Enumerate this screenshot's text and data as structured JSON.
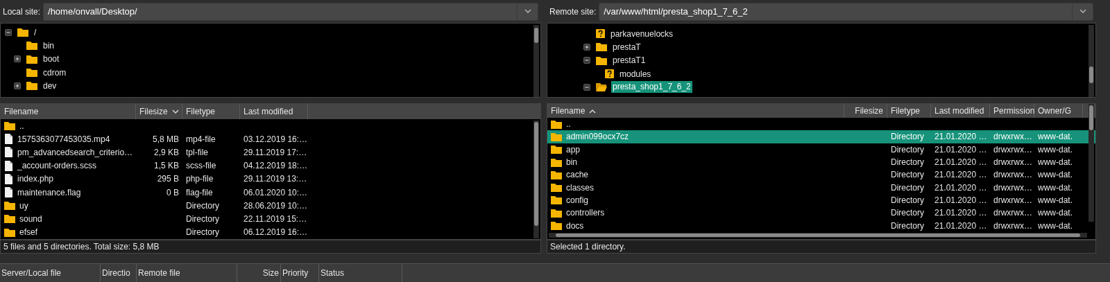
{
  "local": {
    "label": "Local site:",
    "path": "/home/onvall/Desktop/",
    "tree": [
      {
        "name": "/",
        "kind": "folder",
        "expandable": true,
        "expanded": true,
        "selected": false,
        "children": [
          {
            "name": "bin",
            "kind": "folder",
            "expandable": false,
            "selected": false
          },
          {
            "name": "boot",
            "kind": "folder",
            "expandable": true,
            "expanded": false,
            "selected": false
          },
          {
            "name": "cdrom",
            "kind": "folder",
            "expandable": false,
            "selected": false
          },
          {
            "name": "dev",
            "kind": "folder",
            "expandable": true,
            "expanded": false,
            "selected": false
          }
        ]
      }
    ],
    "listing": {
      "columns": [
        {
          "label": "Filename",
          "sorted": false
        },
        {
          "label": "Filesize",
          "sorted": true,
          "ascending": false
        },
        {
          "label": "Filetype",
          "sorted": false
        },
        {
          "label": "Last modified",
          "sorted": false
        }
      ],
      "rows": [
        {
          "kind": "folder",
          "selected": false,
          "filename": ".."
        },
        {
          "kind": "file",
          "selected": false,
          "filename": "1575363077453035.mp4",
          "filesize": "5,8 MB",
          "filetype": "mp4-file",
          "last_modified": "03.12.2019 16:…"
        },
        {
          "kind": "file",
          "selected": false,
          "filename": "pm_advancedsearch_criterio…",
          "filesize": "2,9 KB",
          "filetype": "tpl-file",
          "last_modified": "29.11.2019 17:…"
        },
        {
          "kind": "file",
          "selected": false,
          "filename": "_account-orders.scss",
          "filesize": "1,5 KB",
          "filetype": "scss-file",
          "last_modified": "04.12.2019 18:…"
        },
        {
          "kind": "file",
          "selected": false,
          "filename": "index.php",
          "filesize": "295 B",
          "filetype": "php-file",
          "last_modified": "29.11.2019 13:…"
        },
        {
          "kind": "file",
          "selected": false,
          "filename": "maintenance.flag",
          "filesize": "0 B",
          "filetype": "flag-file",
          "last_modified": "06.01.2020 10:…"
        },
        {
          "kind": "folder",
          "selected": false,
          "filename": "uy",
          "filetype": "Directory",
          "last_modified": "28.06.2019 10:…"
        },
        {
          "kind": "folder",
          "selected": false,
          "filename": "sound",
          "filetype": "Directory",
          "last_modified": "22.11.2019 15:…"
        },
        {
          "kind": "folder",
          "selected": false,
          "filename": "efsef",
          "filetype": "Directory",
          "last_modified": "06.12.2019 16:…"
        }
      ]
    },
    "status": "5 files and 5 directories. Total size: 5,8 MB"
  },
  "remote": {
    "label": "Remote site:",
    "path": "/var/www/html/presta_shop1_7_6_2",
    "tree": [
      {
        "name": "parkavenuelocks",
        "kind": "unknown",
        "expandable": false,
        "selected": false
      },
      {
        "name": "prestaT",
        "kind": "folder",
        "expandable": true,
        "expanded": false,
        "selected": false
      },
      {
        "name": "prestaT1",
        "kind": "folder",
        "expandable": true,
        "expanded": true,
        "selected": false,
        "children": [
          {
            "name": "modules",
            "kind": "unknown",
            "expandable": false,
            "selected": false
          }
        ]
      },
      {
        "name": "presta_shop1_7_6_2",
        "kind": "folder-open",
        "expandable": true,
        "expanded": true,
        "selected": true
      }
    ],
    "listing": {
      "columns": [
        {
          "label": "Filename",
          "sorted": true,
          "ascending": true
        },
        {
          "label": "Filesize",
          "sorted": false
        },
        {
          "label": "Filetype",
          "sorted": false
        },
        {
          "label": "Last modified",
          "sorted": false
        },
        {
          "label": "Permission",
          "sorted": false
        },
        {
          "label": "Owner/G",
          "sorted": false
        }
      ],
      "rows": [
        {
          "kind": "folder",
          "selected": false,
          "filename": ".."
        },
        {
          "kind": "folder",
          "selected": true,
          "filename": "admin099ocx7cz",
          "filetype": "Directory",
          "last_modified": "21.01.2020 …",
          "permission": "drwxrwx…",
          "owner": "www-dat."
        },
        {
          "kind": "folder",
          "selected": false,
          "filename": "app",
          "filetype": "Directory",
          "last_modified": "21.01.2020 …",
          "permission": "drwxrwx…",
          "owner": "www-dat."
        },
        {
          "kind": "folder",
          "selected": false,
          "filename": "bin",
          "filetype": "Directory",
          "last_modified": "21.01.2020 …",
          "permission": "drwxrwx…",
          "owner": "www-dat."
        },
        {
          "kind": "folder",
          "selected": false,
          "filename": "cache",
          "filetype": "Directory",
          "last_modified": "21.01.2020 …",
          "permission": "drwxrwx…",
          "owner": "www-dat."
        },
        {
          "kind": "folder",
          "selected": false,
          "filename": "classes",
          "filetype": "Directory",
          "last_modified": "21.01.2020 …",
          "permission": "drwxrwx…",
          "owner": "www-dat."
        },
        {
          "kind": "folder",
          "selected": false,
          "filename": "config",
          "filetype": "Directory",
          "last_modified": "21.01.2020 …",
          "permission": "drwxrwx…",
          "owner": "www-dat."
        },
        {
          "kind": "folder",
          "selected": false,
          "filename": "controllers",
          "filetype": "Directory",
          "last_modified": "21.01.2020 …",
          "permission": "drwxrwx…",
          "owner": "www-dat."
        },
        {
          "kind": "folder",
          "selected": false,
          "filename": "docs",
          "filetype": "Directory",
          "last_modified": "21.01.2020 …",
          "permission": "drwxrwx…",
          "owner": "www-dat."
        }
      ]
    },
    "status": "Selected 1 directory."
  },
  "queue": {
    "columns": [
      "Server/Local file",
      "Directio",
      "Remote file",
      "Size",
      "Priority",
      "Status"
    ]
  }
}
